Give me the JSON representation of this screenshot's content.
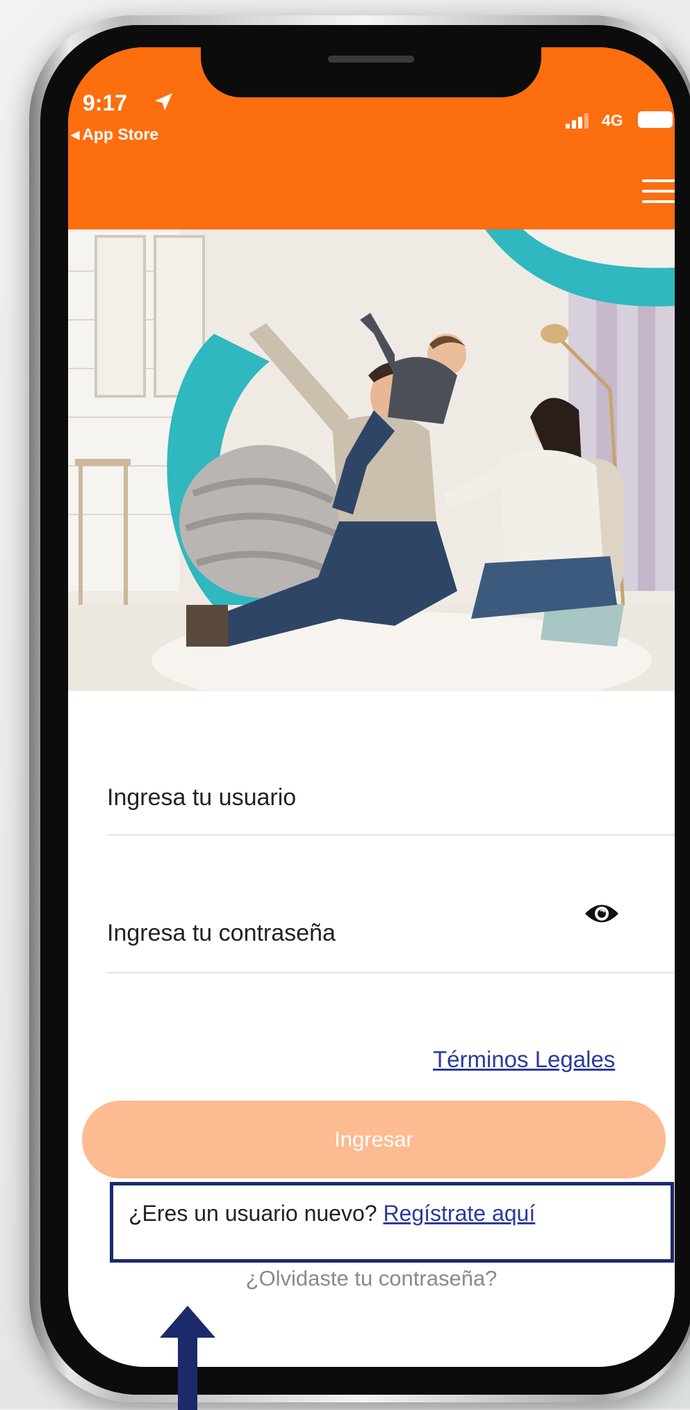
{
  "status_bar": {
    "time": "9:17",
    "back_app": "App Store",
    "network": "4G"
  },
  "header": {
    "background_color": "#fd6e0f",
    "menu_icon": "hamburger-menu-icon"
  },
  "login_form": {
    "username_placeholder": "Ingresa tu usuario",
    "password_placeholder": "Ingresa tu contraseña",
    "password_toggle_icon": "eye-icon",
    "legal_link": "Términos Legales",
    "submit_label": "Ingresar",
    "submit_color": "#fdbb91",
    "new_user_prompt": "¿Eres un usuario nuevo?",
    "register_link": "Regístrate aquí",
    "forgot_password": "¿Olvidaste tu contraseña?"
  },
  "annotation": {
    "highlight_color": "#1c2a6b",
    "pointer": "arrow-up-icon"
  }
}
